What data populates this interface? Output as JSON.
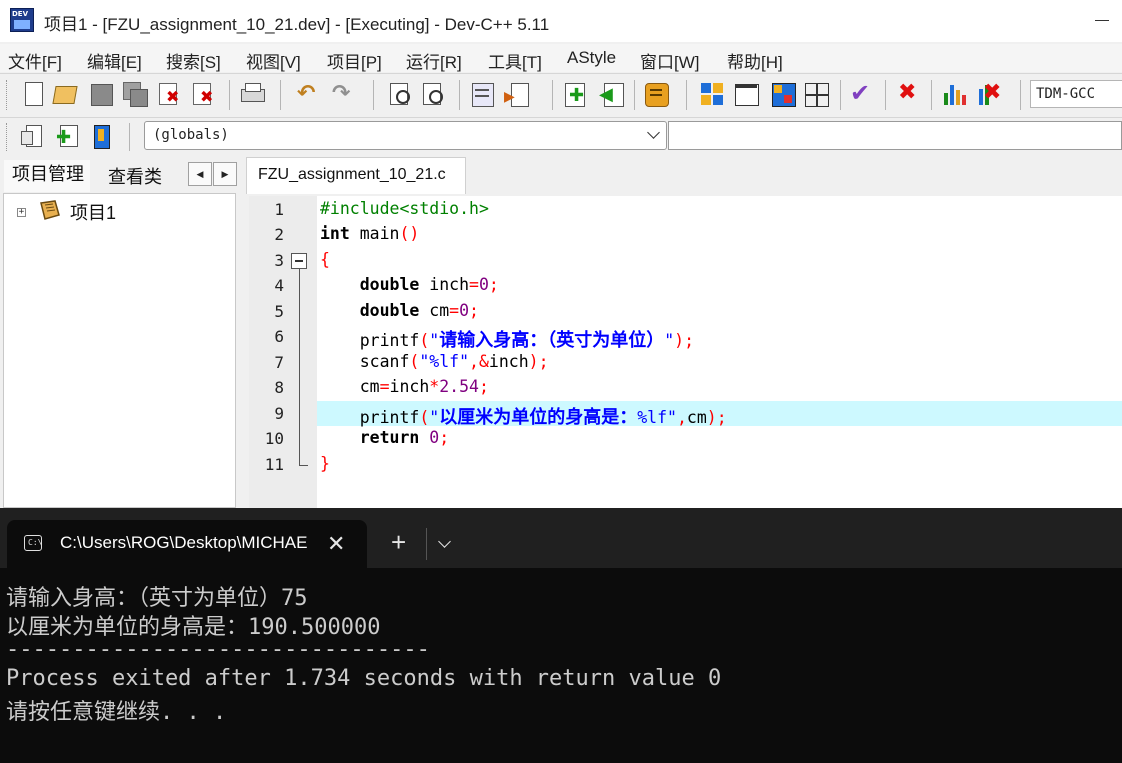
{
  "window": {
    "title": "项目1 - [FZU_assignment_10_21.dev] - [Executing] - Dev-C++ 5.11",
    "app_icon_text": "DEV"
  },
  "menu": [
    "文件[F]",
    "编辑[E]",
    "搜索[S]",
    "视图[V]",
    "项目[P]",
    "运行[R]",
    "工具[T]",
    "AStyle",
    "窗口[W]",
    "帮助[H]"
  ],
  "toolbar": {
    "compiler": "TDM-GCC",
    "icons": [
      "new-file-icon",
      "open-file-icon",
      "save-icon",
      "save-all-icon",
      "close-icon",
      "close-all-icon",
      "print-icon",
      "undo-icon",
      "redo-icon",
      "find-icon",
      "replace-icon",
      "goto-icon",
      "indent-icon",
      "add-to-project-icon",
      "remove-from-project-icon",
      "project-options-icon",
      "compile-icon",
      "run-icon",
      "compile-run-icon",
      "rebuild-icon",
      "syntax-check-icon",
      "stop-icon",
      "chart-icon",
      "profile-delete-icon"
    ]
  },
  "toolbar2": {
    "scope_value": "(globals)"
  },
  "left_panel": {
    "tabs": [
      "项目管理",
      "查看类"
    ],
    "tree": [
      {
        "label": "项目1",
        "expand": "+"
      }
    ]
  },
  "editor": {
    "tab": "FZU_assignment_10_21.c",
    "line_numbers": [
      "1",
      "2",
      "3",
      "4",
      "5",
      "6",
      "7",
      "8",
      "9",
      "10",
      "11"
    ],
    "highlighted_line": 9
  },
  "terminal": {
    "tab_title": "C:\\Users\\ROG\\Desktop\\MICHAEL",
    "lines": [
      "请输入身高：（英寸为单位）75",
      "以厘米为单位的身高是：190.500000",
      "--------------------------------",
      "Process exited after 1.734 seconds with return value 0",
      "请按任意键继续. . ."
    ]
  }
}
